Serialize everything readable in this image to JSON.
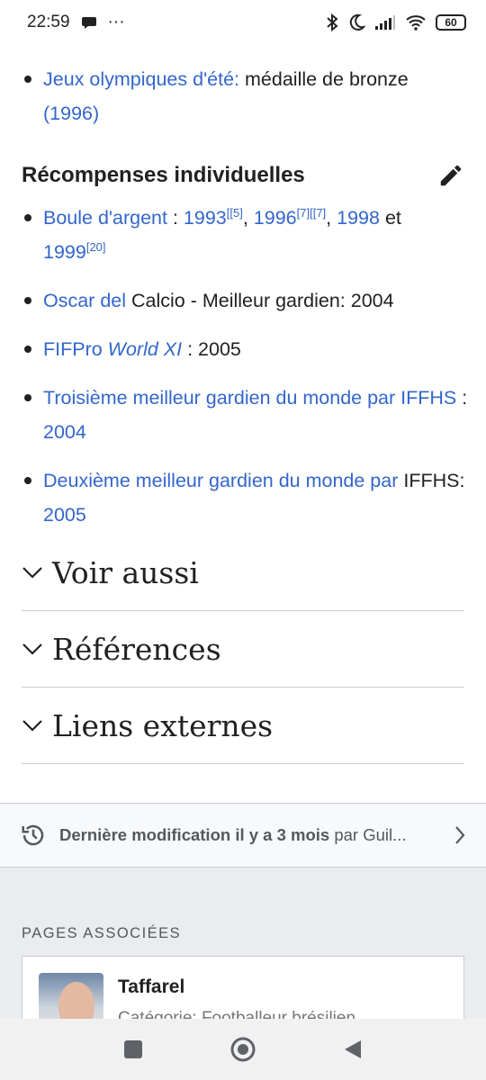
{
  "status": {
    "time": "22:59",
    "dots": "···",
    "battery": "60"
  },
  "olympics": {
    "link": "Jeux olympiques d'été:",
    "text": " médaille de bronze ",
    "year": "(1996)"
  },
  "awards": {
    "heading": "Récompenses individuelles",
    "items": [
      {
        "link": "Boule d'argent",
        "sep": " : ",
        "y1": "1993",
        "r1": "[[5]",
        "c1": ", ",
        "y2": "1996",
        "r2": "[7][[7]",
        "c2": ", ",
        "y3": "1998",
        "and": " et ",
        "y4": "1999",
        "r4": "[20]"
      },
      {
        "link": "Oscar del",
        "text": " Calcio - Meilleur gardien: 2004"
      },
      {
        "link": "FIFPro ",
        "linkItalic": "World XI",
        "text": " : 2005"
      },
      {
        "link": "Troisième meilleur gardien du monde par IFFHS",
        "sep": " : ",
        "year": "2004"
      },
      {
        "link": "Deuxième meilleur gardien du monde par",
        "text": " IFFHS: ",
        "year": "2005"
      }
    ]
  },
  "sections": [
    "Voir aussi",
    "Références",
    "Liens externes"
  ],
  "last_modified": {
    "bold": "Dernière modification il y a 3 mois",
    "rest": " par Guil..."
  },
  "related": {
    "title": "PAGES ASSOCIÉES",
    "card": {
      "name": "Taffarel",
      "desc": "Catégorie: Footballeur brésilien"
    }
  },
  "icons": {
    "edit": "pencil-icon",
    "history": "history-icon"
  }
}
